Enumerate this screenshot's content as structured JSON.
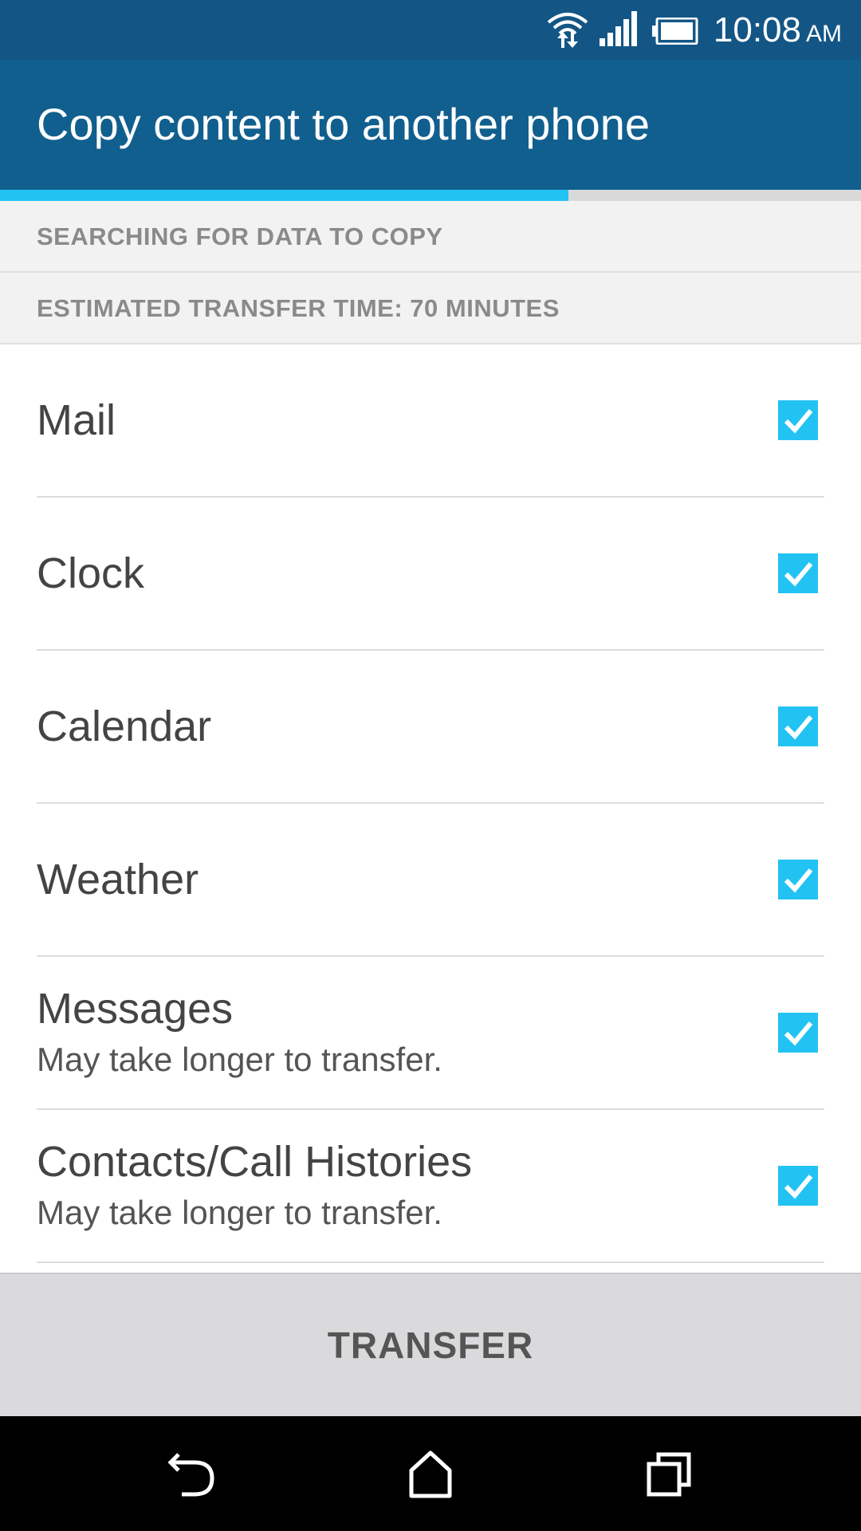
{
  "status_bar": {
    "time": "10:08",
    "ampm": "AM",
    "icons": [
      "wifi-data-icon",
      "signal-icon",
      "battery-icon"
    ]
  },
  "app_bar": {
    "title": "Copy content to another phone"
  },
  "progress": {
    "fraction": 0.66,
    "color": "#22c3f3"
  },
  "info": {
    "status": "SEARCHING FOR DATA TO COPY",
    "estimate": "ESTIMATED TRANSFER TIME: 70 MINUTES"
  },
  "items": [
    {
      "label": "Mail",
      "subtitle": "",
      "checked": true
    },
    {
      "label": "Clock",
      "subtitle": "",
      "checked": true
    },
    {
      "label": "Calendar",
      "subtitle": "",
      "checked": true
    },
    {
      "label": "Weather",
      "subtitle": "",
      "checked": true
    },
    {
      "label": "Messages",
      "subtitle": "May take longer to transfer.",
      "checked": true
    },
    {
      "label": "Contacts/Call Histories",
      "subtitle": "May take longer to transfer.",
      "checked": true
    }
  ],
  "actions": {
    "transfer_label": "TRANSFER"
  },
  "nav": {
    "icons": [
      "back-icon",
      "home-icon",
      "recent-apps-icon"
    ]
  },
  "colors": {
    "status_bar": "#135686",
    "app_bar": "#115f8e",
    "accent": "#22c3f3"
  }
}
